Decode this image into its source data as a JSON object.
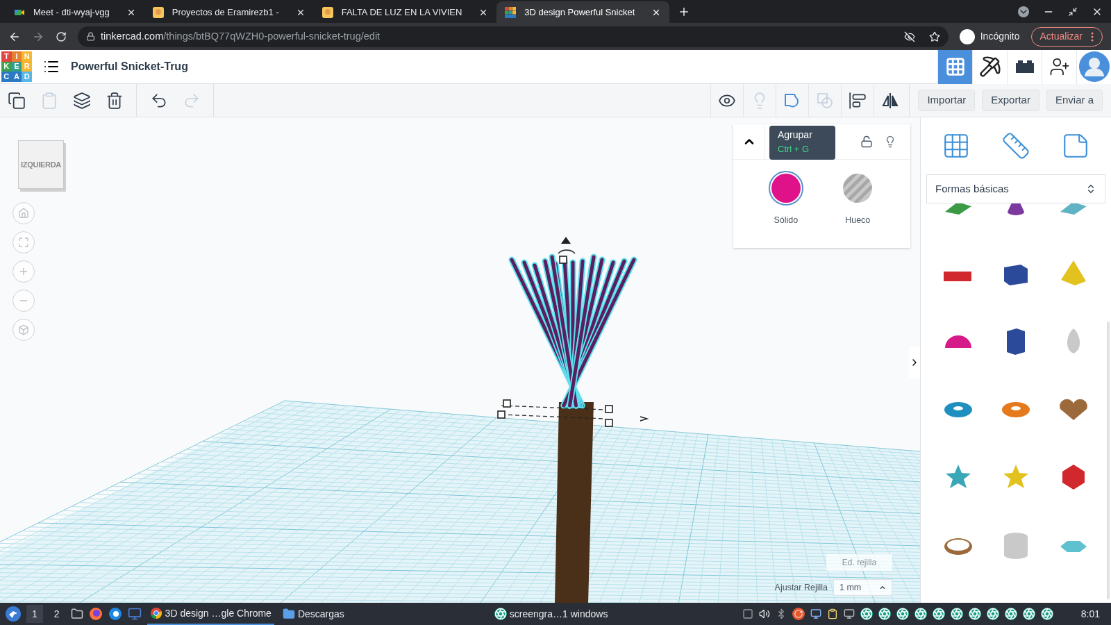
{
  "browser": {
    "tabs": [
      {
        "title": "Meet - dti-wyaj-vgg",
        "selected": false
      },
      {
        "title": "Proyectos de Eramirezb1 -",
        "selected": false
      },
      {
        "title": "FALTA DE LUZ EN LA VIVIEN",
        "selected": false
      },
      {
        "title": "3D design Powerful Snicket",
        "selected": true
      }
    ],
    "url_host": "tinkercad.com",
    "url_path": "/things/btBQ77qWZH0-powerful-snicket-trug/edit",
    "incognito_label": "Incógnito",
    "update_button": "Actualizar"
  },
  "app": {
    "logo_letters": [
      "T",
      "I",
      "N",
      "K",
      "E",
      "R",
      "C",
      "A",
      "D"
    ],
    "design_title": "Powerful Snicket-Trug",
    "header_icons": [
      {
        "kind": "grid",
        "selected": true
      },
      {
        "kind": "pickaxe",
        "selected": false
      },
      {
        "kind": "bricks",
        "selected": false
      },
      {
        "kind": "add-user",
        "selected": false
      },
      {
        "kind": "avatar",
        "selected": false
      }
    ],
    "edit_tools": [
      {
        "kind": "copy",
        "disabled": false
      },
      {
        "kind": "paste",
        "disabled": true
      },
      {
        "kind": "duplicate",
        "disabled": false
      },
      {
        "kind": "delete",
        "disabled": false
      },
      {
        "kind": "undo",
        "disabled": false
      },
      {
        "kind": "redo",
        "disabled": true
      }
    ],
    "shape_tools": [
      {
        "kind": "notes",
        "disabled": false
      },
      {
        "kind": "light",
        "disabled": true
      },
      {
        "kind": "group",
        "disabled": false
      },
      {
        "kind": "ungroup",
        "disabled": true
      },
      {
        "kind": "align",
        "disabled": false
      },
      {
        "kind": "mirror",
        "disabled": false
      }
    ],
    "action_buttons": [
      "Importar",
      "Exportar",
      "Enviar a"
    ]
  },
  "viewport": {
    "view_cube_label": "IZQUIERDA",
    "tooltip": {
      "title": "Agrupar",
      "shortcut": "Ctrl + G"
    },
    "inspector": {
      "options": [
        {
          "label": "Sólido",
          "kind": "solid",
          "selected": true
        },
        {
          "label": "Hueco",
          "kind": "hole",
          "selected": false
        }
      ]
    },
    "edit_grid_button": "Ed. rejilla",
    "snap_grid_label": "Ajustar Rejilla",
    "snap_grid_value": "1 mm"
  },
  "library": {
    "category": "Formas básicas"
  },
  "taskbar": {
    "workspaces": [
      {
        "label": "1",
        "selected": true
      },
      {
        "label": "2",
        "selected": false
      }
    ],
    "windows": [
      {
        "label": "3D design …gle Chrome",
        "selected": true
      },
      {
        "label": "Descargas",
        "selected": false
      },
      {
        "label": "screengra…1 windows",
        "selected": false
      }
    ],
    "clock": "8:01"
  }
}
